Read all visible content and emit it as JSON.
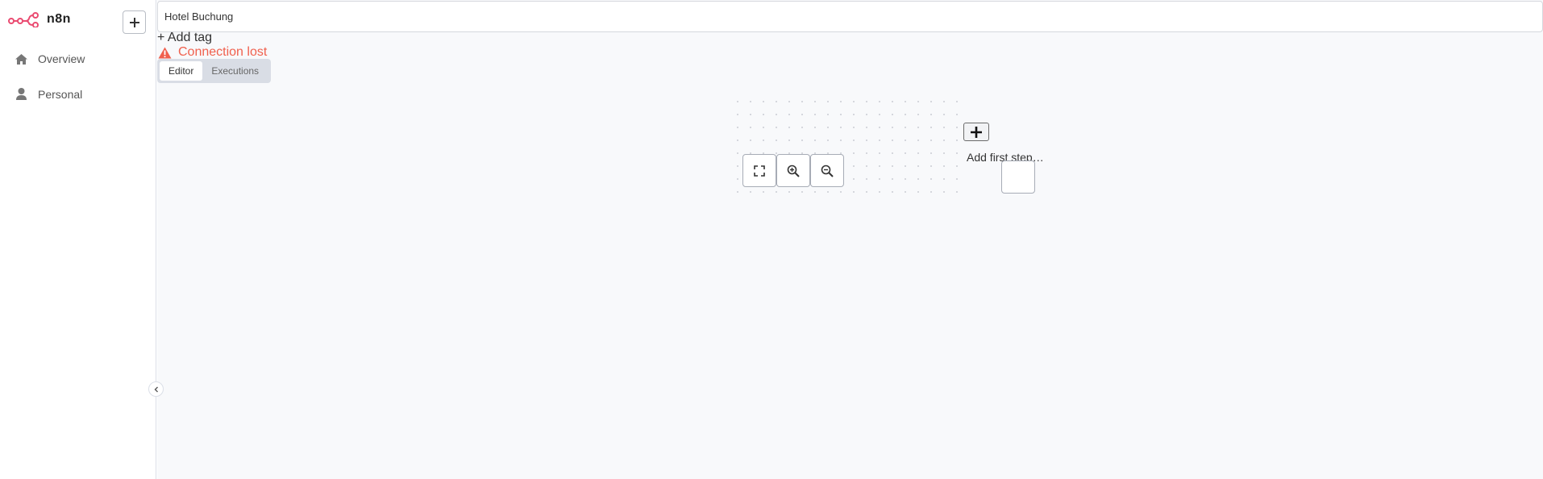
{
  "app": {
    "name": "n8n",
    "brand_color": "#ea4b71"
  },
  "sidebar": {
    "add_icon": "plus-icon",
    "items": [
      {
        "label": "Overview",
        "icon": "home-icon"
      },
      {
        "label": "Personal",
        "icon": "user-icon"
      }
    ],
    "collapse_icon": "chevron-left-icon"
  },
  "workflow": {
    "name": "Hotel Buchung",
    "add_tag": "+ Add tag"
  },
  "status": {
    "text": "Connection lost",
    "icon": "warning-icon",
    "color": "#f0604d"
  },
  "tabs": [
    {
      "label": "Editor",
      "active": true
    },
    {
      "label": "Executions",
      "active": false
    }
  ],
  "canvas": {
    "add_first_step": "Add first step…",
    "controls": [
      "fit-view-icon",
      "zoom-in-icon",
      "zoom-out-icon"
    ]
  }
}
